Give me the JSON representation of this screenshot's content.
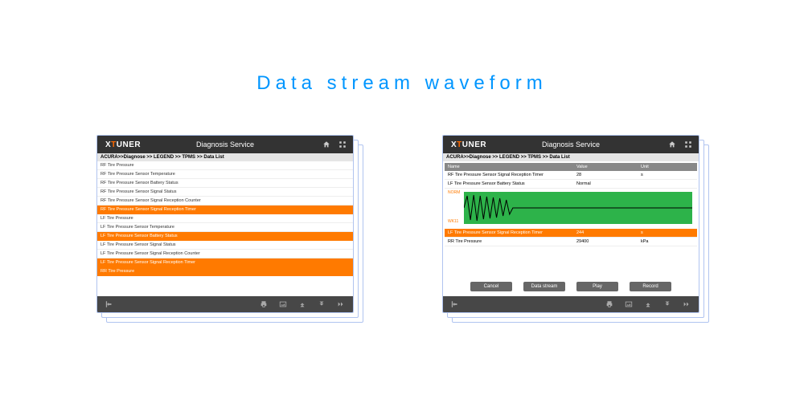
{
  "title": "Data stream waveform",
  "brand": {
    "pre": "X",
    "accent": "T",
    "post": "UNER"
  },
  "header_title": "Diagnosis Service",
  "breadcrumb": "ACURA>>Diagnose >> LEGEND >> TPMS >> Data List",
  "left_rows": [
    {
      "label": "RF Tire Pressure",
      "sel": false
    },
    {
      "label": "RF Tire Pressure Sensor Temperature",
      "sel": false
    },
    {
      "label": "RF Tire Pressure Sensor Battery Status",
      "sel": false
    },
    {
      "label": "RF Tire Pressure Sensor Signal Status",
      "sel": false
    },
    {
      "label": "RF Tire Pressure Sensor Signal Reception Counter",
      "sel": false
    },
    {
      "label": "RF Tire Pressure Sensor Signal Reception Timer",
      "sel": true
    },
    {
      "label": "LF Tire Pressure",
      "sel": false
    },
    {
      "label": "LF Tire Pressure Sensor Temperature",
      "sel": false
    },
    {
      "label": "LF Tire Pressure Sensor Battery Status",
      "sel": true
    },
    {
      "label": "LF Tire Pressure Sensor Signal Status",
      "sel": false
    },
    {
      "label": "LF Tire Pressure Sensor Signal Reception Counter",
      "sel": false
    },
    {
      "label": "LF Tire Pressure Sensor Signal Reception Timer",
      "sel": true
    },
    {
      "label": "RR Tire Pressure",
      "sel": true
    }
  ],
  "right": {
    "cols": {
      "name": "Name",
      "value": "Value",
      "unit": "Unit"
    },
    "rows_top": [
      {
        "name": "RF Tire Pressure Sensor Signal Reception Timer",
        "value": "28",
        "unit": "s",
        "sel": false
      },
      {
        "name": "LF Tire Pressure Sensor Battery Status",
        "value": "Normal",
        "unit": "",
        "sel": false
      }
    ],
    "wave": {
      "top": "NORM",
      "bot": "WK11"
    },
    "rows_bot": [
      {
        "name": "LF Tire Pressure Sensor Signal Reception Timer",
        "value": "244",
        "unit": "s",
        "sel": true
      },
      {
        "name": "RR Tire Pressure",
        "value": "29400",
        "unit": "kPa",
        "sel": false
      }
    ],
    "buttons": [
      "Cancel",
      "Data stream",
      "Play",
      "Record"
    ]
  }
}
